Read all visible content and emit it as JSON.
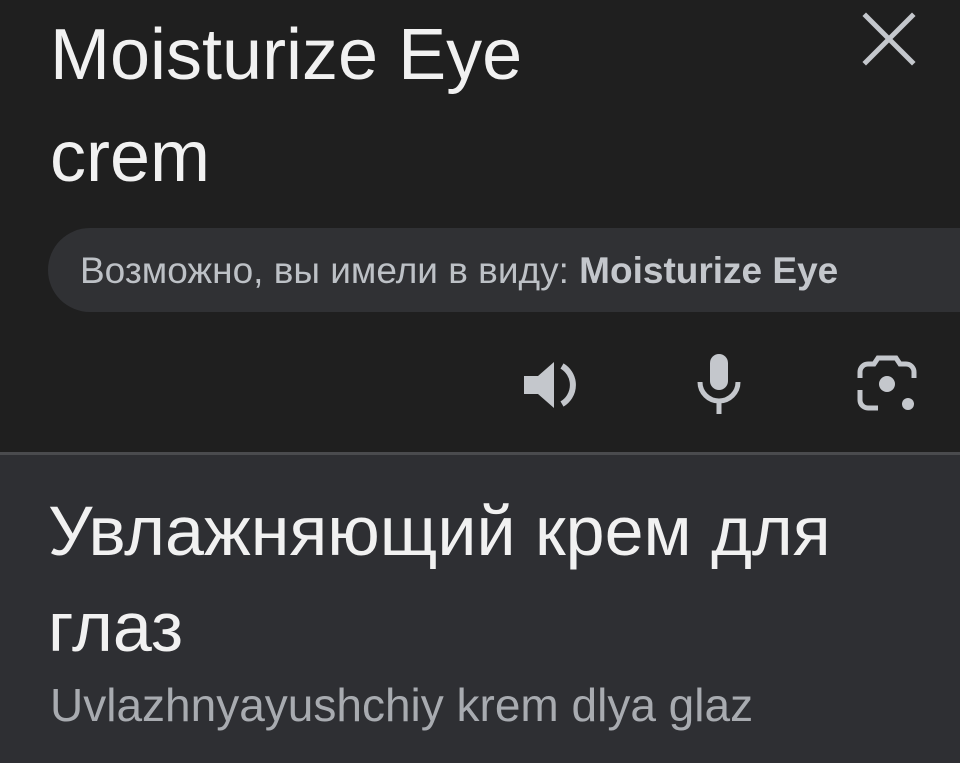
{
  "source": {
    "text": "Moisturize Eye\ncrem",
    "close_icon": "close-icon"
  },
  "suggestion": {
    "prefix": "Возможно, вы имели в виду: ",
    "term": "Moisturize Eye"
  },
  "actions": {
    "listen_icon": "speaker-icon",
    "mic_icon": "microphone-icon",
    "camera_icon": "camera-icon"
  },
  "translation": {
    "text": "Увлажняющий крем для глаз",
    "transliteration": "Uvlazhnyayushchiy krem dlya glaz"
  },
  "colors": {
    "background": "#1f1f1f",
    "pill": "#303134",
    "result_panel": "#2e2f33",
    "icon": "#c4c7cc"
  }
}
